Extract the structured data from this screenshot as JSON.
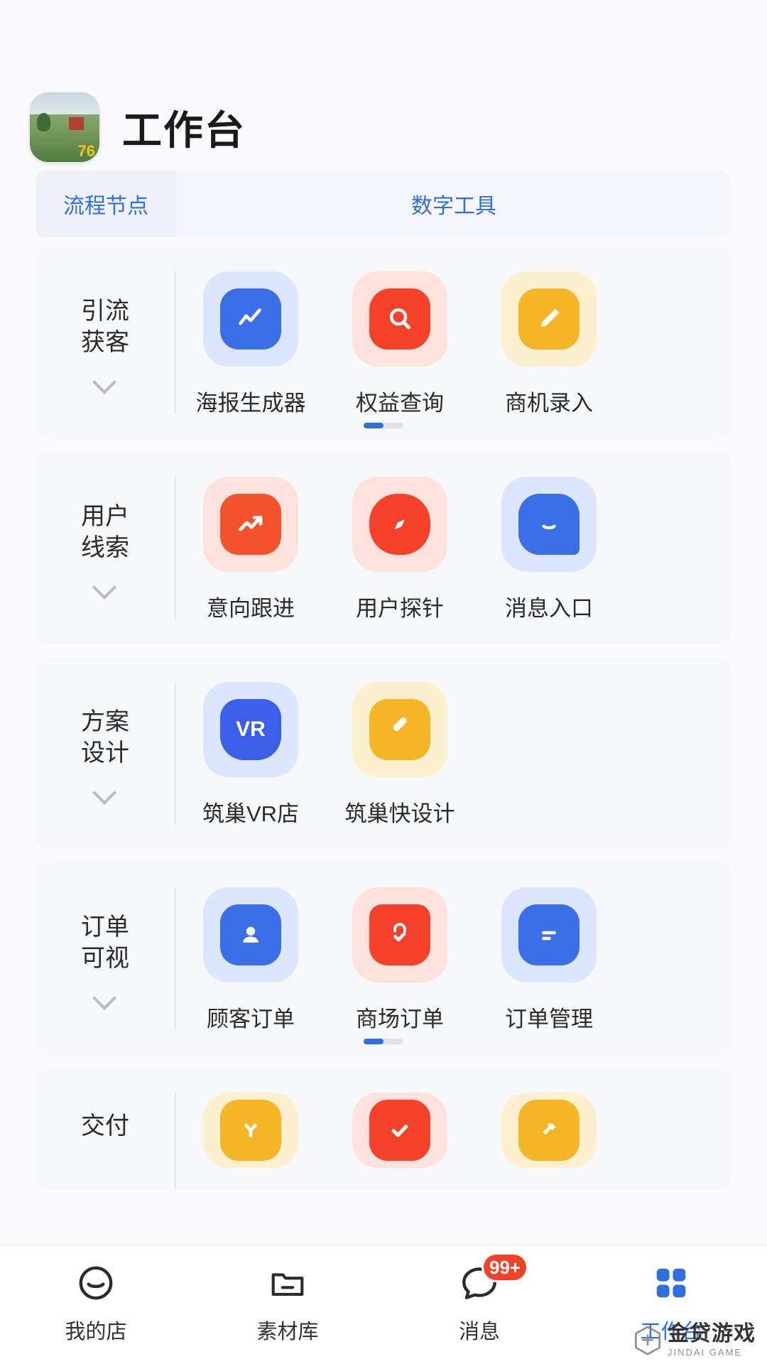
{
  "header": {
    "app_name": "工作台",
    "logo_badge": "76"
  },
  "tabs": [
    {
      "label": "流程节点",
      "active": true
    },
    {
      "label": "数字工具",
      "active": false
    }
  ],
  "groups": [
    {
      "label": "引流\n获客",
      "label_line1": "引流",
      "label_line2": "获客",
      "has_pager": true,
      "items": [
        {
          "label": "海报生成器",
          "icon": "chart-poster-icon",
          "icon_bg": "#dce7fd",
          "icon_fg": "#3b6fe8"
        },
        {
          "label": "权益查询",
          "icon": "search-icon",
          "icon_bg": "#fde3dc",
          "icon_fg": "#f4412a"
        },
        {
          "label": "商机录入",
          "icon": "pencil-icon",
          "icon_bg": "#fdf0cf",
          "icon_fg": "#f5b526"
        }
      ]
    },
    {
      "label_line1": "用户",
      "label_line2": "线索",
      "has_pager": false,
      "items": [
        {
          "label": "意向跟进",
          "icon": "trend-up-icon",
          "icon_bg": "#fde3dc",
          "icon_fg": "#f4522a"
        },
        {
          "label": "用户探针",
          "icon": "compass-icon",
          "icon_bg": "#fde3dc",
          "icon_fg": "#f4412a"
        },
        {
          "label": "消息入口",
          "icon": "chat-bubble-icon",
          "icon_bg": "#dce7fd",
          "icon_fg": "#3b6fe8"
        }
      ]
    },
    {
      "label_line1": "方案",
      "label_line2": "设计",
      "has_pager": false,
      "items": [
        {
          "label": "筑巢VR店",
          "icon": "vr-icon",
          "icon_bg": "#dce7fd",
          "icon_fg": "#3b5fe8",
          "icon_text": "VR"
        },
        {
          "label": "筑巢快设计",
          "icon": "ruler-pen-icon",
          "icon_bg": "#fdf0cf",
          "icon_fg": "#f5b526"
        }
      ]
    },
    {
      "label_line1": "订单",
      "label_line2": "可视",
      "has_pager": true,
      "items": [
        {
          "label": "顾客订单",
          "icon": "user-card-icon",
          "icon_bg": "#dce7fd",
          "icon_fg": "#3b6fe8"
        },
        {
          "label": "商场订单",
          "icon": "bag-check-icon",
          "icon_bg": "#fde3dc",
          "icon_fg": "#f4412a"
        },
        {
          "label": "订单管理",
          "icon": "list-doc-icon",
          "icon_bg": "#dce7fd",
          "icon_fg": "#3b6fe8"
        }
      ]
    },
    {
      "label_line1": "交付",
      "label_line2": "",
      "has_pager": false,
      "items": [
        {
          "label": "",
          "icon": "bulb-icon",
          "icon_bg": "#fdf0cf",
          "icon_fg": "#f5b526"
        },
        {
          "label": "",
          "icon": "check-icon",
          "icon_bg": "#fde3dc",
          "icon_fg": "#f4412a"
        },
        {
          "label": "",
          "icon": "hammer-icon",
          "icon_bg": "#fdf0cf",
          "icon_fg": "#f5b526"
        }
      ]
    }
  ],
  "bottom_nav": [
    {
      "label": "我的店",
      "icon": "store-icon",
      "active": false,
      "badge": ""
    },
    {
      "label": "素材库",
      "icon": "folder-icon",
      "active": false,
      "badge": ""
    },
    {
      "label": "消息",
      "icon": "message-icon",
      "active": false,
      "badge": "99+"
    },
    {
      "label": "工作台",
      "icon": "grid-icon",
      "active": true,
      "badge": ""
    }
  ],
  "watermark": {
    "cn": "金贷游戏",
    "en": "JINDAI GAME"
  },
  "colors": {
    "accent": "#2f6fe0",
    "red": "#f4412a",
    "yellow": "#f5b526",
    "page_bg": "#fbfbfd",
    "card_bg": "#f7f8fa"
  }
}
